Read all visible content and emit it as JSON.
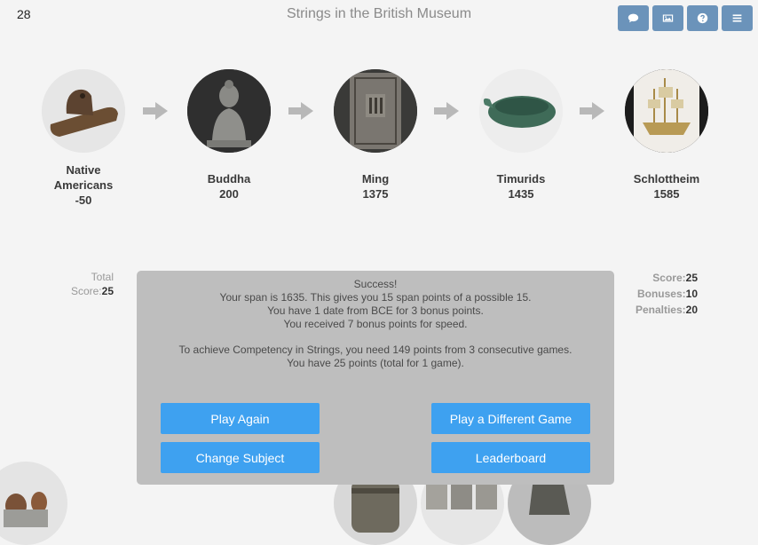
{
  "header": {
    "counter": "28",
    "title": "Strings in the British Museum",
    "buttons": [
      {
        "icon": "comment-icon"
      },
      {
        "icon": "image-icon"
      },
      {
        "icon": "help-icon"
      },
      {
        "icon": "menu-icon"
      }
    ]
  },
  "timeline": [
    {
      "name_line1": "Native",
      "name_line2": "Americans",
      "year": "-50",
      "image": "stone-bird-pipe"
    },
    {
      "name_line1": "Buddha",
      "year": "200",
      "image": "seated-buddha-statue"
    },
    {
      "name_line1": "Ming",
      "year": "1375",
      "image": "ming-banknote"
    },
    {
      "name_line1": "Timurids",
      "year": "1435",
      "image": "jade-cup"
    },
    {
      "name_line1": "Schlottheim",
      "year": "1585",
      "image": "gilded-nef-ship"
    }
  ],
  "stats_left": {
    "label1": "Total",
    "label2": "Score:",
    "value": "25"
  },
  "stats_right": [
    {
      "label": "Score:",
      "value": "25"
    },
    {
      "label": "Bonuses:",
      "value": "10"
    },
    {
      "label": "Penalties:",
      "value": "20"
    }
  ],
  "result": {
    "line1": "Success!",
    "line2": "Your span is 1635. This gives you 15 span points of a possible 15.",
    "line3": "You have 1 date from BCE for 3 bonus points.",
    "line4": "You received 7 bonus points for speed.",
    "line5": "To achieve Competency in Strings, you need 149 points from 3 consecutive games.",
    "line6": "You have 25 points (total for 1 game)."
  },
  "buttons": {
    "play_again": "Play Again",
    "different_game": "Play a Different Game",
    "change_subject": "Change Subject",
    "leaderboard": "Leaderboard"
  },
  "colors": {
    "button": "#3ea1f0",
    "toolbar": "#6b93ba",
    "overlay": "#bebebe"
  }
}
